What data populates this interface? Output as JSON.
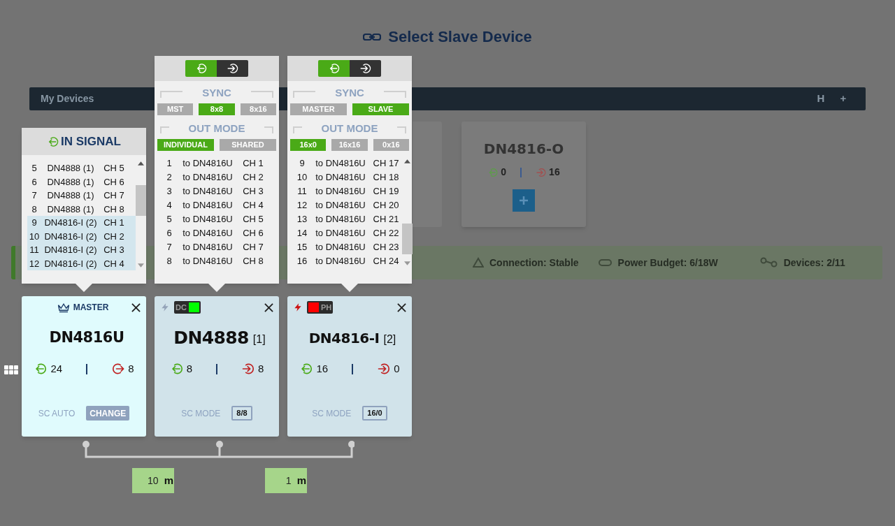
{
  "title": "Select Slave Device",
  "background": {
    "devices_bar": {
      "title": "My Devices",
      "actions": [
        "H",
        "+"
      ]
    },
    "device_card": {
      "name": "DN4816-O",
      "in_count": "0",
      "out_count": "16"
    },
    "status": [
      {
        "kind": "connection",
        "text": "Connection: Stable"
      },
      {
        "kind": "power",
        "text": "Power Budget: 6/18W"
      },
      {
        "kind": "devices",
        "text": "Devices: 2/11"
      }
    ]
  },
  "in_signal": {
    "title": "IN SIGNAL",
    "rows": [
      {
        "number": "5",
        "source": "DN4888 (1)",
        "channel": "CH 5",
        "selected": false
      },
      {
        "number": "6",
        "source": "DN4888 (1)",
        "channel": "CH 6",
        "selected": false
      },
      {
        "number": "7",
        "source": "DN4888 (1)",
        "channel": "CH 7",
        "selected": false
      },
      {
        "number": "8",
        "source": "DN4888 (1)",
        "channel": "CH 8",
        "selected": false
      },
      {
        "number": "9",
        "source": "DN4816-I (2)",
        "channel": "CH 1",
        "selected": true
      },
      {
        "number": "10",
        "source": "DN4816-I (2)",
        "channel": "CH 2",
        "selected": true
      },
      {
        "number": "11",
        "source": "DN4816-I (2)",
        "channel": "CH 3",
        "selected": true
      },
      {
        "number": "12",
        "source": "DN4816-I (2)",
        "channel": "CH 4",
        "selected": true
      }
    ]
  },
  "devices": [
    {
      "card": {
        "kind": "master",
        "label": "MASTER",
        "name": "DN4816U",
        "in_count": "24",
        "out_count": "8",
        "footer_label": "SC AUTO",
        "footer_button": "CHANGE"
      }
    },
    {
      "popover": {
        "toggle": [
          {
            "kind": "in",
            "selected": true
          },
          {
            "kind": "out",
            "selected": false
          }
        ],
        "sync": {
          "label": "SYNC",
          "options": [
            {
              "label": "MST",
              "selected": false
            },
            {
              "label": "8x8",
              "selected": true
            },
            {
              "label": "8x16",
              "selected": false
            }
          ]
        },
        "out_mode": {
          "label": "OUT MODE",
          "options": [
            {
              "label": "INDIVIDUAL",
              "selected": true
            },
            {
              "label": "SHARED",
              "selected": false
            }
          ]
        },
        "scrollable": false,
        "rows": [
          {
            "number": "1",
            "target": "to DN4816U",
            "channel": "CH 1"
          },
          {
            "number": "2",
            "target": "to DN4816U",
            "channel": "CH 2"
          },
          {
            "number": "3",
            "target": "to DN4816U",
            "channel": "CH 3"
          },
          {
            "number": "4",
            "target": "to DN4816U",
            "channel": "CH 4"
          },
          {
            "number": "5",
            "target": "to DN4816U",
            "channel": "CH 5"
          },
          {
            "number": "6",
            "target": "to DN4816U",
            "channel": "CH 6"
          },
          {
            "number": "7",
            "target": "to DN4816U",
            "channel": "CH 7"
          },
          {
            "number": "8",
            "target": "to DN4816U",
            "channel": "CH 8"
          }
        ]
      },
      "card": {
        "kind": "slave",
        "power_icon": {
          "color": "#94a3b8"
        },
        "badge": {
          "kind": "light_after",
          "text": "DC",
          "color": "#00ff00"
        },
        "name": "DN4888",
        "index": "[1]",
        "in_count": "8",
        "out_count": "8",
        "footer_label": "SC MODE",
        "footer_value": "8/8"
      }
    },
    {
      "popover": {
        "toggle": [
          {
            "kind": "in",
            "selected": true
          },
          {
            "kind": "out",
            "selected": false
          }
        ],
        "sync": {
          "label": "SYNC",
          "options": [
            {
              "label": "MASTER",
              "selected": false
            },
            {
              "label": "SLAVE",
              "selected": true
            }
          ]
        },
        "out_mode": {
          "label": "OUT MODE",
          "options": [
            {
              "label": "16x0",
              "selected": true
            },
            {
              "label": "16x16",
              "selected": false
            },
            {
              "label": "0x16",
              "selected": false
            }
          ]
        },
        "scrollable": true,
        "rows": [
          {
            "number": "9",
            "target": "to DN4816U",
            "channel": "CH 17"
          },
          {
            "number": "10",
            "target": "to DN4816U",
            "channel": "CH 18"
          },
          {
            "number": "11",
            "target": "to DN4816U",
            "channel": "CH 19"
          },
          {
            "number": "12",
            "target": "to DN4816U",
            "channel": "CH 20"
          },
          {
            "number": "13",
            "target": "to DN4816U",
            "channel": "CH 21"
          },
          {
            "number": "14",
            "target": "to DN4816U",
            "channel": "CH 22"
          },
          {
            "number": "15",
            "target": "to DN4816U",
            "channel": "CH 23"
          },
          {
            "number": "16",
            "target": "to DN4816U",
            "channel": "CH 24"
          }
        ]
      },
      "card": {
        "kind": "slave",
        "power_icon": {
          "color": "#cc1111"
        },
        "badge": {
          "kind": "light_before",
          "text": "PH",
          "color": "#ff0000"
        },
        "name": "DN4816-I",
        "index": "[2]",
        "in_count": "16",
        "out_count": "0",
        "footer_label": "SC MODE",
        "footer_value": "16/0"
      }
    }
  ],
  "cable_lengths": [
    {
      "value": "10",
      "unit": "m"
    },
    {
      "value": "1",
      "unit": "m"
    }
  ]
}
